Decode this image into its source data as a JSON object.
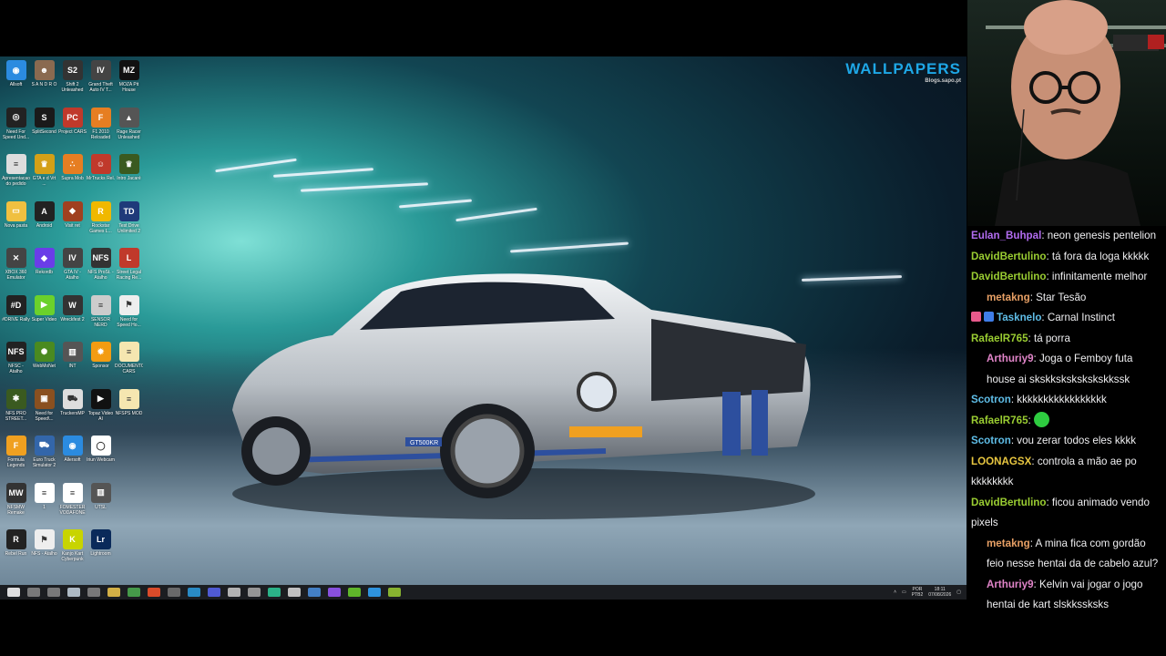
{
  "wallpaper": {
    "logo_title": "WALLPAPERS",
    "logo_sub": "Blogs.sapo.pt",
    "plate": "GT500KR"
  },
  "desktop_icons": [
    {
      "label": "Allsoft",
      "icon": "blue-globe-icon",
      "color": "#2b8be0",
      "glyph": "◉"
    },
    {
      "label": "S A N D R O",
      "icon": "portrait-icon",
      "color": "#8a6a50",
      "glyph": "☻"
    },
    {
      "label": "Shift 2 Unleashed",
      "icon": "shift2-icon",
      "color": "#333333",
      "glyph": "S2"
    },
    {
      "label": "Grand Theft Auto IV T...",
      "icon": "gta4-icon",
      "color": "#444444",
      "glyph": "IV"
    },
    {
      "label": "MOZA Pit House",
      "icon": "moza-icon",
      "color": "#111111",
      "glyph": "MZ"
    },
    {
      "label": "Need For Speed Und...",
      "icon": "nfs-icon",
      "color": "#222222",
      "glyph": "◎"
    },
    {
      "label": "SplitSecond",
      "icon": "splitsecond-icon",
      "color": "#1a1a1a",
      "glyph": "S"
    },
    {
      "label": "Project CARS",
      "icon": "project-cars-icon",
      "color": "#c0392b",
      "glyph": "PC"
    },
    {
      "label": "F1 2010 Reloaded",
      "icon": "f1-icon",
      "color": "#e67e22",
      "glyph": "F"
    },
    {
      "label": "Rage Racer Unleashed",
      "icon": "car-icon",
      "color": "#555555",
      "glyph": "▲"
    },
    {
      "label": "Apresentacao do pedido",
      "icon": "document-icon",
      "color": "#dddddd",
      "glyph": "≡"
    },
    {
      "label": "GTA e d Vrt ...",
      "icon": "crown-icon",
      "color": "#d4a017",
      "glyph": "♛"
    },
    {
      "label": "Supra Mob",
      "icon": "dots-icon",
      "color": "#e67e22",
      "glyph": "∴"
    },
    {
      "label": "MrTrucks Rel.",
      "icon": "roblox-icon",
      "color": "#c0392b",
      "glyph": "☺"
    },
    {
      "label": "Intro Jacaré",
      "icon": "crown-green-icon",
      "color": "#3a5a20",
      "glyph": "♛"
    },
    {
      "label": "Nova pasta",
      "icon": "folder-icon",
      "color": "#f0c040",
      "glyph": "▭"
    },
    {
      "label": "Android",
      "icon": "android-a-icon",
      "color": "#222222",
      "glyph": "A"
    },
    {
      "label": "Visit ret",
      "icon": "game-icon",
      "color": "#a04020",
      "glyph": "◆"
    },
    {
      "label": "Rockstar Games L...",
      "icon": "rockstar-icon",
      "color": "#f0b800",
      "glyph": "R"
    },
    {
      "label": "Test Drive Unlimited 2",
      "icon": "tdu-icon",
      "color": "#1f3a7a",
      "glyph": "TD"
    },
    {
      "label": "XBOX 360 Emulator",
      "icon": "xbox-icon",
      "color": "#444444",
      "glyph": "✕"
    },
    {
      "label": "Rekordb",
      "icon": "diamond-icon",
      "color": "#6a3de8",
      "glyph": "◆"
    },
    {
      "label": "GTA IV - Atalho",
      "icon": "gta4-icon",
      "color": "#444444",
      "glyph": "IV"
    },
    {
      "label": "NFS ProSt. - Atalho",
      "icon": "nfs-prostreet-icon",
      "color": "#333333",
      "glyph": "NFS"
    },
    {
      "label": "Street Legal Racing Re...",
      "icon": "slr-icon",
      "color": "#c0392b",
      "glyph": "L"
    },
    {
      "label": "#DRIVE Rally",
      "icon": "drive-icon",
      "color": "#222222",
      "glyph": "#D"
    },
    {
      "label": "Super Video",
      "icon": "play-icon",
      "color": "#6bd12b",
      "glyph": "▶"
    },
    {
      "label": "Wreckfest 2",
      "icon": "wreckfest-icon",
      "color": "#333333",
      "glyph": "W"
    },
    {
      "label": "SENSOR NERD",
      "icon": "document-icon",
      "color": "#cccccc",
      "glyph": "≡"
    },
    {
      "label": "Need for Speed Ho...",
      "icon": "nfs-hot-icon",
      "color": "#eeeeee",
      "glyph": "⚑"
    },
    {
      "label": "NFSC - Atalho",
      "icon": "nfs-carbon-icon",
      "color": "#222222",
      "glyph": "NFS"
    },
    {
      "label": "WebMoNet",
      "icon": "wheel-icon",
      "color": "#4a8a20",
      "glyph": "✺"
    },
    {
      "label": "INT",
      "icon": "stripe-icon",
      "color": "#555555",
      "glyph": "▥"
    },
    {
      "label": "Sponsor",
      "icon": "sun-icon",
      "color": "#f39c12",
      "glyph": "✹"
    },
    {
      "label": "DOCUMENTOS CARS",
      "icon": "document-icon",
      "color": "#f5e6b0",
      "glyph": "≡"
    },
    {
      "label": "NFS PRO STREET...",
      "icon": "nfs-mod-icon",
      "color": "#3a5a20",
      "glyph": "✱"
    },
    {
      "label": "Need for Speed\\...",
      "icon": "nfs-box-icon",
      "color": "#8a5020",
      "glyph": "▣"
    },
    {
      "label": "TruckersMP",
      "icon": "truck-icon",
      "color": "#dddddd",
      "glyph": "⛟"
    },
    {
      "label": "Topaz Video AI",
      "icon": "topaz-icon",
      "color": "#111111",
      "glyph": "▶"
    },
    {
      "label": "NFSPS MOD",
      "icon": "document-icon",
      "color": "#f5e6b0",
      "glyph": "≡"
    },
    {
      "label": "Formula Legends",
      "icon": "formula-icon",
      "color": "#f0a020",
      "glyph": "F"
    },
    {
      "label": "Euro Truck Simulator 2",
      "icon": "ets2-icon",
      "color": "#3366aa",
      "glyph": "⛟"
    },
    {
      "label": "Allersoft",
      "icon": "blue-globe-icon",
      "color": "#2b8be0",
      "glyph": "◉"
    },
    {
      "label": "Iriun Webcam",
      "icon": "webcam-icon",
      "color": "#ffffff",
      "glyph": "◯"
    },
    {
      "label": "",
      "icon": "empty-icon",
      "color": "transparent",
      "glyph": ""
    },
    {
      "label": "NFSMW Remake",
      "icon": "nfsmw-icon",
      "color": "#333333",
      "glyph": "MW"
    },
    {
      "label": "1",
      "icon": "document-icon",
      "color": "#ffffff",
      "glyph": "≡"
    },
    {
      "label": "FOMESTER VODAFONE",
      "icon": "document-icon",
      "color": "#ffffff",
      "glyph": "≡"
    },
    {
      "label": "UTSL",
      "icon": "stripe-icon",
      "color": "#555555",
      "glyph": "▥"
    },
    {
      "label": "",
      "icon": "empty-icon",
      "color": "transparent",
      "glyph": ""
    },
    {
      "label": "Rebel Run",
      "icon": "rebel-icon",
      "color": "#222222",
      "glyph": "R"
    },
    {
      "label": "NFS - Atalho",
      "icon": "nfs-hot-icon",
      "color": "#eeeeee",
      "glyph": "⚑"
    },
    {
      "label": "Kanjo Kart Cyberpunk",
      "icon": "kart-icon",
      "color": "#c8d400",
      "glyph": "K"
    },
    {
      "label": "Lightroom",
      "icon": "lightroom-icon",
      "color": "#0a2a5a",
      "glyph": "Lr"
    }
  ],
  "taskbar": {
    "apps": [
      {
        "icon": "windows-start-icon",
        "color": "#ffffff"
      },
      {
        "icon": "search-icon",
        "color": "#888888"
      },
      {
        "icon": "task-view-icon",
        "color": "#888888"
      },
      {
        "icon": "steam-icon",
        "color": "#c7d5e0"
      },
      {
        "icon": "settings-icon",
        "color": "#888888"
      },
      {
        "icon": "file-explorer-icon",
        "color": "#f2c94c"
      },
      {
        "icon": "chrome-icon",
        "color": "#4caf50"
      },
      {
        "icon": "brave-icon",
        "color": "#fb542b"
      },
      {
        "icon": "calculator-icon",
        "color": "#777777"
      },
      {
        "icon": "edge-icon",
        "color": "#2b9de0"
      },
      {
        "icon": "discord-icon",
        "color": "#5865f2"
      },
      {
        "icon": "obs-icon",
        "color": "#cccccc"
      },
      {
        "icon": "notes-icon",
        "color": "#aaaaaa"
      },
      {
        "icon": "audition-icon",
        "color": "#2ecc9a"
      },
      {
        "icon": "game-icon",
        "color": "#dddddd"
      },
      {
        "icon": "vpn-icon",
        "color": "#4a90e2"
      },
      {
        "icon": "premiere-icon",
        "color": "#9b59ff"
      },
      {
        "icon": "green-arrow-icon",
        "color": "#6bd12b"
      },
      {
        "icon": "photoshop-icon",
        "color": "#31a8ff"
      },
      {
        "icon": "crown-icon",
        "color": "#9acd32"
      }
    ],
    "tray_lang": "POR",
    "tray_lang2": "PTB2",
    "time": "18:11",
    "date": "07/08/2026"
  },
  "chat": [
    {
      "user": "Eulan_Buhpal",
      "color": "#b26cf0",
      "text": "neon genesis pentelion",
      "indent": false,
      "badges": []
    },
    {
      "user": "DavidBertulino",
      "color": "#9acd32",
      "text": "tá fora da loga kkkkk",
      "indent": false,
      "badges": []
    },
    {
      "user": "DavidBertulino",
      "color": "#9acd32",
      "text": "infinitamente melhor",
      "indent": false,
      "badges": []
    },
    {
      "user": "metakng",
      "color": "#e8a065",
      "text": "Star Tesão",
      "indent": true,
      "badges": []
    },
    {
      "user": "Tasknelo",
      "color": "#5fbde7",
      "text": "Carnal Instinct",
      "indent": false,
      "badges": [
        {
          "icon": "gift-badge-icon",
          "color": "#e85a8c"
        },
        {
          "icon": "hammer-badge-icon",
          "color": "#3f7de8"
        }
      ]
    },
    {
      "user": "RafaelR765",
      "color": "#9acd32",
      "text": "tá porra",
      "indent": false,
      "badges": []
    },
    {
      "user": "Arthuriy9",
      "color": "#e084c8",
      "text": "Joga o Femboy futa house ai skskkskskskskskkssk",
      "indent": true,
      "badges": []
    },
    {
      "user": "Scotron",
      "color": "#5fbde7",
      "text": "kkkkkkkkkkkkkkkkk",
      "indent": false,
      "badges": []
    },
    {
      "user": "RafaelR765",
      "color": "#9acd32",
      "text": "",
      "indent": false,
      "badges": [],
      "emote": "green-blob-emote-icon"
    },
    {
      "user": "Scotron",
      "color": "#5fbde7",
      "text": "vou zerar todos eles kkkk",
      "indent": false,
      "badges": []
    },
    {
      "user": "LOONAGSX",
      "color": "#e8c640",
      "text": "controla a mão ae po kkkkkkkk",
      "indent": false,
      "badges": []
    },
    {
      "user": "DavidBertulino",
      "color": "#9acd32",
      "text": "ficou animado vendo pixels",
      "indent": false,
      "badges": []
    },
    {
      "user": "metakng",
      "color": "#e8a065",
      "text": "A mina fica com gordão feio nesse hentai da de cabelo azul?",
      "indent": true,
      "badges": []
    },
    {
      "user": "Arthuriy9",
      "color": "#e084c8",
      "text": "Kelvin vai jogar o jogo hentai de kart slskkssksks",
      "indent": true,
      "badges": []
    }
  ]
}
